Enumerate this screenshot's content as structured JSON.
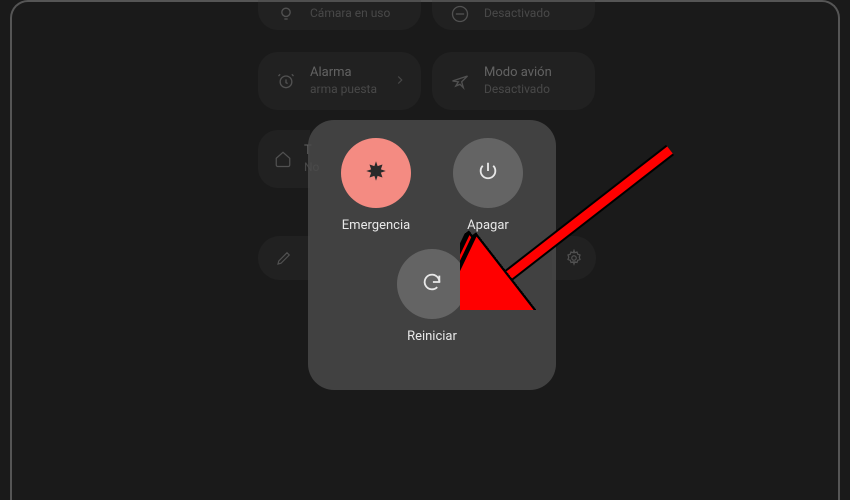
{
  "tiles": {
    "camera": {
      "title": "",
      "subtitle": "Cámara en uso"
    },
    "dnd": {
      "title": "",
      "subtitle": "Desactivado"
    },
    "alarm": {
      "title": "Alarma",
      "subtitle": "arma puesta"
    },
    "airplane": {
      "title": "Modo avión",
      "subtitle": "Desactivado"
    },
    "home": {
      "title": "T",
      "subtitle": "No"
    }
  },
  "powerMenu": {
    "emergency": "Emergencia",
    "shutdown": "Apagar",
    "restart": "Reiniciar"
  }
}
